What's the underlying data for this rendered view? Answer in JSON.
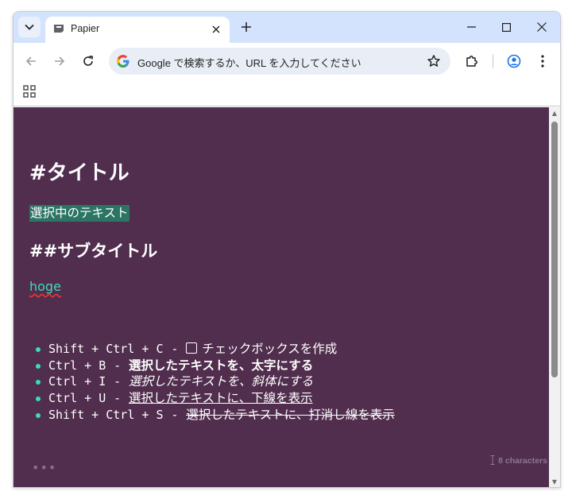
{
  "browser": {
    "tab": {
      "title": "Papier",
      "favicon": "papier-icon"
    },
    "omnibox": {
      "placeholder": "Google で検索するか、URL を入力してください"
    },
    "icons": {
      "tab_search": "chevron-down-icon",
      "tab_close": "close-icon",
      "new_tab": "plus-icon",
      "minimize": "minimize-icon",
      "maximize": "maximize-icon",
      "close_window": "close-icon",
      "back": "back-arrow-icon",
      "forward": "forward-arrow-icon",
      "reload": "reload-icon",
      "google": "google-icon",
      "bookmark": "star-icon",
      "extensions": "puzzle-icon",
      "profile": "profile-icon",
      "menu": "kebab-menu-icon",
      "apps": "apps-grid-icon"
    }
  },
  "editor": {
    "colors": {
      "background": "#512e4e",
      "selection": "#2c7565",
      "accent": "#3fdcb2",
      "text": "#ffffff"
    },
    "heading1": "#タイトル",
    "selected_text": "選択中のテキスト",
    "heading2": "##サブタイトル",
    "link_text": "hoge",
    "shortcuts": [
      {
        "keys": "Shift + Ctrl + C",
        "sep": "-",
        "desc": "チェックボックスを作成"
      },
      {
        "keys": "Ctrl + B",
        "sep": "-",
        "desc": "選択したテキストを、太字にする"
      },
      {
        "keys": "Ctrl + I",
        "sep": "-",
        "desc": "選択したテキストを、斜体にする"
      },
      {
        "keys": "Ctrl + U",
        "sep": "-",
        "desc": "選択したテキストに、下線を表示"
      },
      {
        "keys": "Shift + Ctrl + S",
        "sep": "-",
        "desc": "選択したテキストに、打消し線を表示"
      }
    ],
    "more_menu": "•••",
    "char_count": "8 characters"
  }
}
